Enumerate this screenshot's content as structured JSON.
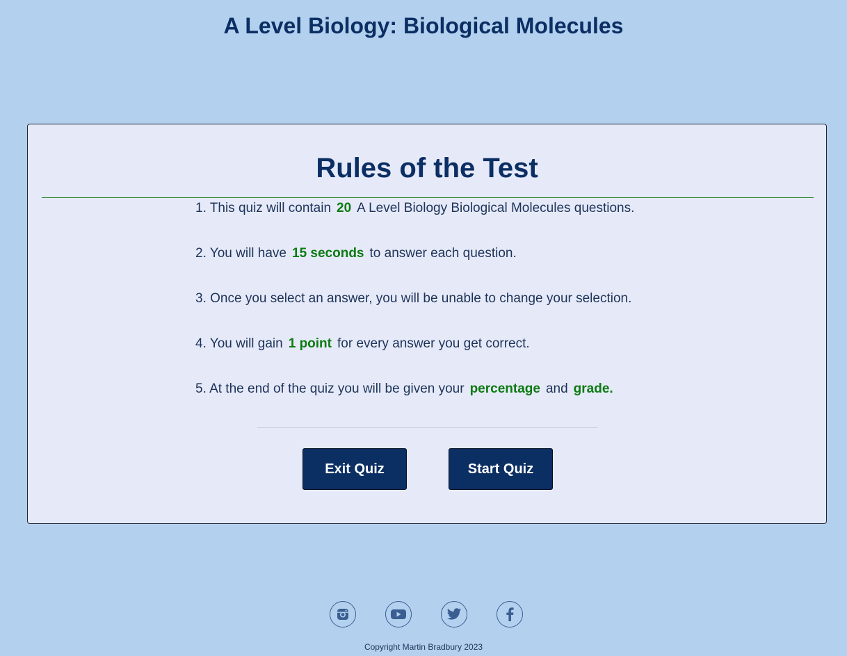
{
  "header": {
    "title": "A Level Biology: Biological Molecules"
  },
  "rules": {
    "heading": "Rules of the Test",
    "items": [
      {
        "prefix": "1. This quiz will contain",
        "highlight": "20",
        "suffix": "A Level Biology Biological Molecules questions."
      },
      {
        "prefix": "2. You will have",
        "highlight": "15 seconds",
        "suffix": "to answer each question."
      },
      {
        "text": "3. Once you select an answer, you will be unable to change your selection."
      },
      {
        "prefix": "4. You will gain",
        "highlight": "1 point",
        "suffix": "for every answer you get correct."
      },
      {
        "prefix": "5. At the end of the quiz you will be given your",
        "highlight": "percentage",
        "middle": "and",
        "highlight2": "grade."
      }
    ]
  },
  "buttons": {
    "exit_label": "Exit Quiz",
    "start_label": "Start Quiz"
  },
  "footer": {
    "social": [
      "instagram-icon",
      "youtube-icon",
      "twitter-icon",
      "facebook-icon"
    ],
    "copyright": "Copyright Martin Bradbury 2023"
  },
  "colors": {
    "background": "#b3d1ef",
    "card": "#e6eaf8",
    "navy": "#0b2e63",
    "highlight_green": "#0c7a12"
  }
}
